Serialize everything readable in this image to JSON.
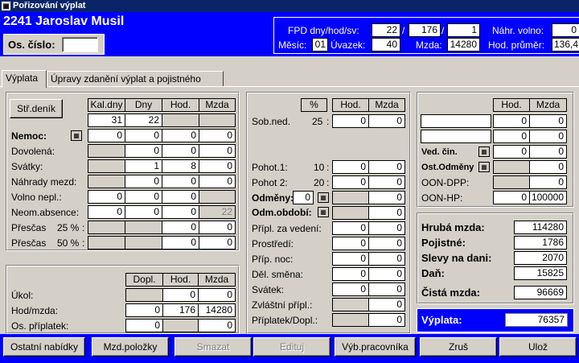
{
  "window": {
    "title": "Pořizování výplat"
  },
  "header": {
    "employee": "2241 Jaroslav Musil",
    "os_cislo_label": "Os. číslo:",
    "os_cislo_value": ""
  },
  "info": {
    "fpd_label": "FPD dny/hod/sv:",
    "fpd_days": "22",
    "fpd_hours": "176",
    "fpd_sv": "1",
    "sep1": "/",
    "sep2": "/",
    "month_label": "Měsíc:",
    "month": "01",
    "uvazek_label": "Úvazek:",
    "uvazek": "40",
    "mzda_label": "Mzda:",
    "mzda": "14280",
    "nahr_label": "Náhr. volno:",
    "nahr": "0",
    "prumer_label": "Hod. průměr:",
    "prumer": "136,4"
  },
  "tabs": [
    {
      "label": "Výplata"
    },
    {
      "label": "Úpravy zdanění výplat a pojistného"
    }
  ],
  "left": {
    "button": "Stř.deník",
    "cols": [
      "Kal.dny",
      "Dny",
      "Hod.",
      "Mzda"
    ],
    "top": [
      "31",
      "22"
    ],
    "rows": [
      {
        "label": "Nemoc:",
        "c": [
          "0",
          "0",
          "0",
          "0"
        ]
      },
      {
        "label": "Dovolená:",
        "c": [
          "",
          "0",
          "0",
          "0"
        ]
      },
      {
        "label": "Svátky:",
        "c": [
          "",
          "1",
          "8",
          "0"
        ]
      },
      {
        "label": "Náhrady mezd:",
        "c": [
          "",
          "0",
          "0",
          "0"
        ]
      },
      {
        "label": "Volno nepl.:",
        "c": [
          "0",
          "0",
          "0",
          ""
        ]
      },
      {
        "label": "Neom.absence:",
        "c": [
          "0",
          "0",
          "0",
          "22"
        ]
      },
      {
        "label": "Přesčas",
        "pct": "25 %",
        "sfx": ":",
        "c": [
          "",
          "",
          "0",
          "0"
        ]
      },
      {
        "label": "Přesčas",
        "pct": "50 %",
        "sfx": ":",
        "c": [
          "",
          "",
          "0",
          "0"
        ]
      }
    ]
  },
  "bottom_left": {
    "cols": [
      "Dopl.",
      "Hod.",
      "Mzda"
    ],
    "rows": [
      {
        "label": "Úkol:",
        "c": [
          "",
          "0",
          "0"
        ]
      },
      {
        "label": "Hod/mzda:",
        "c": [
          "0",
          "176",
          "14280"
        ]
      },
      {
        "label": "Os. příplatek:",
        "c": [
          "0",
          "",
          "0"
        ]
      }
    ]
  },
  "middle": {
    "cols": [
      "%",
      "Hod.",
      "Mzda"
    ],
    "sob": {
      "label": "Sob.ned.",
      "pct": "25",
      "hod": "0",
      "mzda": "0"
    },
    "pohot": [
      {
        "label": "Pohot.1:",
        "pct": "10",
        "hod": "0",
        "mzda": "0"
      },
      {
        "label": "Pohot 2:",
        "pct": "20",
        "hod": "0",
        "mzda": "0"
      }
    ],
    "odmeny": {
      "label": "Odměny:",
      "val": "0",
      "mzda": "0"
    },
    "odm_obdobi": {
      "label": "Odm.období:",
      "mzda": "0"
    },
    "rows": [
      {
        "label": "Přípl. za vedení:",
        "hod": "0",
        "mzda": "0"
      },
      {
        "label": "Prostředí:",
        "hod": "0",
        "mzda": "0"
      },
      {
        "label": "Příp. noc:",
        "hod": "0",
        "mzda": "0"
      },
      {
        "label": "Děl. směna:",
        "hod": "0",
        "mzda": "0"
      },
      {
        "label": "Svátek:",
        "hod": "0",
        "mzda": "0"
      },
      {
        "label": "Zvláštní přípl.:",
        "hod": "",
        "mzda": "0"
      },
      {
        "label": "Příplatek/Dopl.:",
        "hod": "",
        "mzda": "0"
      }
    ]
  },
  "right": {
    "cols": [
      "Hod.",
      "Mzda"
    ],
    "rows": [
      {
        "label": "",
        "hod": "0",
        "mzda": "0"
      },
      {
        "label": "",
        "hod": "0",
        "mzda": "0"
      },
      {
        "label": "Ved. čin.",
        "hod": "0",
        "mzda": "0"
      },
      {
        "label": "Ost.Odměny",
        "hod": "",
        "mzda": "0"
      },
      {
        "label": "OON-DPP:",
        "hod": "",
        "mzda": "0"
      },
      {
        "label": "OON-HP:",
        "hod": "0",
        "mzda": "100000"
      }
    ]
  },
  "summary": {
    "hruba_label": "Hrubá mzda:",
    "hruba": "114280",
    "pojistne_label": "Pojistné:",
    "pojistne": "1786",
    "slevy_label": "Slevy na dani:",
    "slevy": "2070",
    "dan_label": "Daň:",
    "dan": "15825",
    "cista_label": "Čistá mzda:",
    "cista": "96669",
    "vyplata_label": "Výplata:",
    "vyplata": "76357"
  },
  "buttons": {
    "ostatni": "Ostatní nabídky",
    "mzd": "Mzd.položky",
    "smazat": "Smazat",
    "edituj": "Edituj",
    "vyb": "Výb.pracovníka",
    "zrus": "Zruš",
    "uloz": "Ulož"
  },
  "colors": {
    "titlebar": "#0a246a",
    "header": "#0000ff",
    "face": "#d4d0c8"
  }
}
